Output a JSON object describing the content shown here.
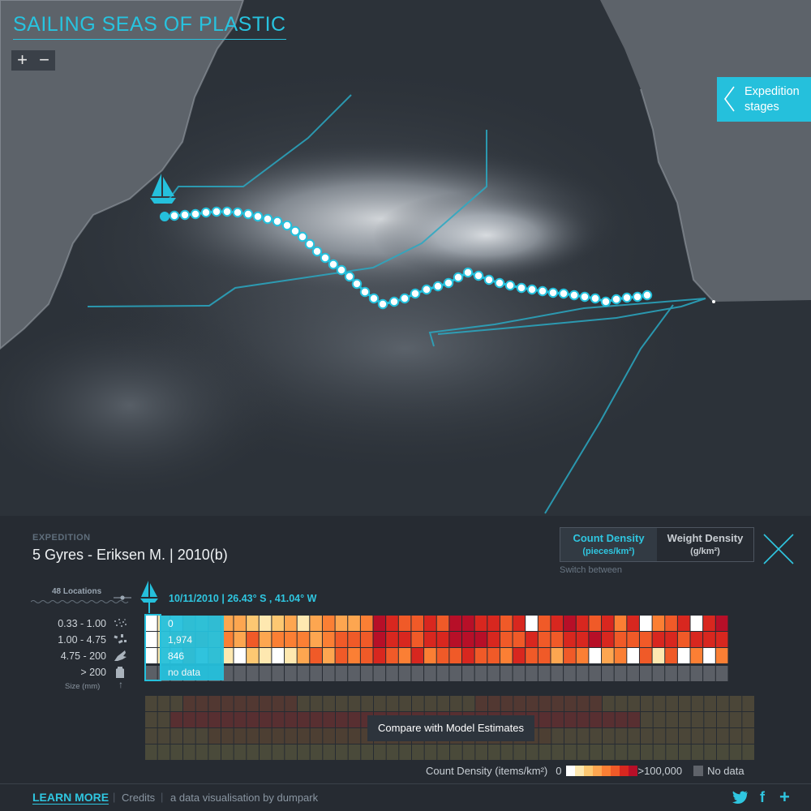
{
  "app": {
    "title": "SAILING SEAS OF PLASTIC",
    "zoom_in": "+",
    "zoom_out": "−",
    "stages_label": "Expedition stages"
  },
  "expedition": {
    "kicker": "EXPEDITION",
    "title": "5 Gyres - Eriksen M.  |  2010(b)",
    "locations_label": "48 Locations",
    "date_coords": "10/11/2010  |  26.43° S , 41.04° W"
  },
  "toggle": {
    "count_label": "Count Density",
    "count_unit": "(pieces/km²)",
    "weight_label": "Weight Density",
    "weight_unit": "(g/km²)",
    "hint": "Switch between"
  },
  "size_classes": [
    {
      "label": "0.33 - 1.00",
      "icon": "dust-icon"
    },
    {
      "label": "1.00 - 4.75",
      "icon": "fragments-icon"
    },
    {
      "label": "4.75 - 200",
      "icon": "bird-icon"
    },
    {
      "label": "> 200",
      "icon": "bottle-icon"
    }
  ],
  "size_unit": "Size (mm)",
  "size_arrow": "↑",
  "current_values": [
    "0",
    "1,974",
    "846",
    "no data"
  ],
  "legend": {
    "label": "Count Density (items/km²)",
    "min": "0",
    "max": ">100,000",
    "nodata": "No data",
    "colors": [
      "#ffffff",
      "#fee8b0",
      "#fdc872",
      "#fda650",
      "#fb7f34",
      "#f05a28",
      "#d8271f",
      "#b70f28"
    ]
  },
  "compare_label": "Compare with Model Estimates",
  "footer": {
    "learn_more": "LEARN MORE",
    "credits": "Credits",
    "byline": "a data visualisation by dumpark",
    "twitter": "twitter-icon",
    "facebook": "f",
    "plus": "+"
  },
  "heatmap": {
    "rows": [
      [
        0,
        1,
        0,
        3,
        2,
        4,
        3,
        3,
        2,
        1,
        2,
        3,
        1,
        3,
        4,
        3,
        3,
        4,
        7,
        6,
        5,
        5,
        6,
        5,
        7,
        7,
        6,
        6,
        5,
        6,
        0,
        5,
        6,
        7,
        6,
        5,
        6,
        4,
        6,
        0,
        4,
        5,
        6,
        0,
        6,
        7
      ],
      [
        0,
        1,
        3,
        4,
        4,
        3,
        4,
        3,
        5,
        3,
        4,
        4,
        4,
        3,
        4,
        5,
        5,
        5,
        7,
        6,
        6,
        5,
        6,
        6,
        7,
        7,
        7,
        6,
        5,
        5,
        6,
        5,
        5,
        6,
        6,
        7,
        6,
        5,
        5,
        5,
        6,
        6,
        5,
        6,
        6,
        6
      ],
      [
        0,
        1,
        0,
        4,
        0,
        3,
        1,
        0,
        2,
        1,
        0,
        1,
        3,
        5,
        3,
        5,
        4,
        5,
        6,
        5,
        4,
        6,
        4,
        5,
        5,
        6,
        5,
        5,
        4,
        6,
        5,
        5,
        3,
        5,
        4,
        0,
        3,
        4,
        0,
        5,
        1,
        5,
        0,
        4,
        0,
        4
      ],
      [
        -1,
        -1,
        -1,
        -1,
        -1,
        -1,
        -1,
        -1,
        -1,
        -1,
        -1,
        -1,
        -1,
        -1,
        -1,
        -1,
        -1,
        -1,
        -1,
        -1,
        -1,
        -1,
        -1,
        -1,
        -1,
        -1,
        -1,
        -1,
        -1,
        -1,
        -1,
        -1,
        -1,
        -1,
        -1,
        -1,
        -1,
        -1,
        -1,
        -1,
        -1,
        -1,
        -1,
        -1,
        -1,
        -1
      ]
    ]
  }
}
